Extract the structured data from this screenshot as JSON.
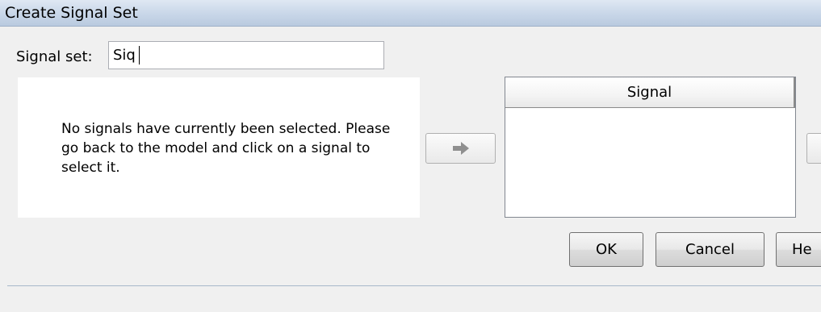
{
  "window": {
    "title": "Create Signal Set"
  },
  "signal_set": {
    "label": "Signal set:",
    "value": "Siq"
  },
  "message": {
    "text": "No signals have currently been selected. Please go back to the model and click on a signal to select it."
  },
  "add_button": {
    "icon": "right-arrow-icon"
  },
  "signal_list": {
    "column_header": "Signal",
    "items": []
  },
  "buttons": {
    "ok": "OK",
    "cancel": "Cancel",
    "help": "He"
  },
  "colors": {
    "title_bar": "#c8d6e8",
    "panel_background": "#ffffff",
    "window_background": "#f0f0f0"
  }
}
